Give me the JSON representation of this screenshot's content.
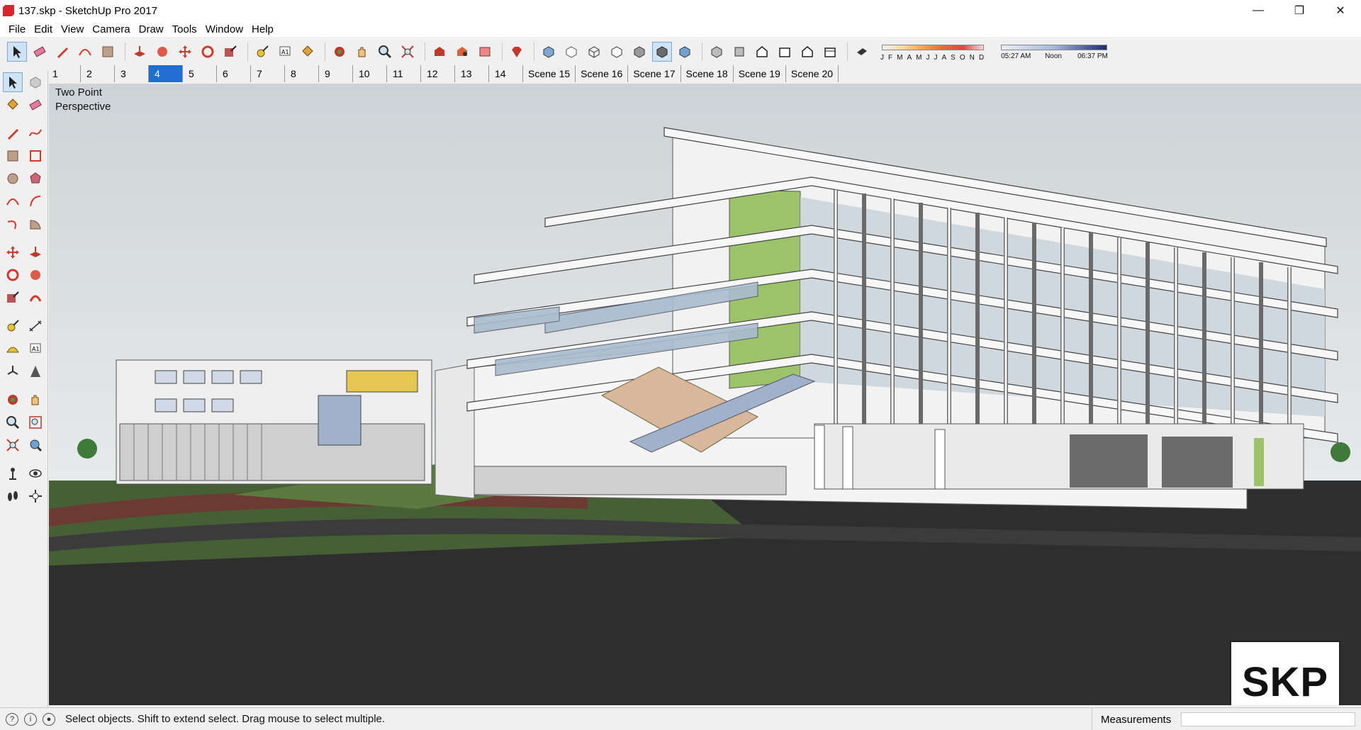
{
  "window": {
    "title": "137.skp - SketchUp Pro 2017",
    "controls": [
      "minimize",
      "restore",
      "close"
    ]
  },
  "menu": [
    "File",
    "Edit",
    "View",
    "Camera",
    "Draw",
    "Tools",
    "Window",
    "Help"
  ],
  "shadow_settings": {
    "months": [
      "J",
      "F",
      "M",
      "A",
      "M",
      "J",
      "J",
      "A",
      "S",
      "O",
      "N",
      "D"
    ],
    "sunrise": "05:27 AM",
    "noon": "Noon",
    "sunset": "06:37 PM"
  },
  "scenes": {
    "tabs": [
      "1",
      "2",
      "3",
      "4",
      "5",
      "6",
      "7",
      "8",
      "9",
      "10",
      "11",
      "12",
      "13",
      "14",
      "Scene 15",
      "Scene 16",
      "Scene 17",
      "Scene 18",
      "Scene 19",
      "Scene 20"
    ],
    "active": "4"
  },
  "viewport": {
    "view_label_line1": "Two Point",
    "view_label_line2": "Perspective",
    "logo": "SKP"
  },
  "status": {
    "message": "Select objects. Shift to extend select. Drag mouse to select multiple.",
    "measurements_label": "Measurements",
    "measurements_value": ""
  },
  "colors": {
    "sky": "#d7dcdd",
    "ground_dark": "#2e2e2e",
    "grass": "#4f6f3a",
    "accent_green": "#9cc36a",
    "active_tab": "#1e6fd1"
  }
}
